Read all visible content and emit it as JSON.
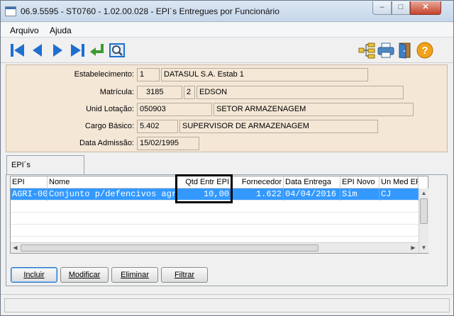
{
  "window": {
    "title": "06.9.5595 - ST0760 - 1.02.00.028 - EPI´s Entregues por Funcionário"
  },
  "menu": {
    "items": [
      {
        "label": "Arquivo"
      },
      {
        "label": "Ajuda"
      }
    ]
  },
  "toolbar": {
    "icons": [
      "first-icon",
      "previous-icon",
      "next-icon",
      "last-icon",
      "goto-icon",
      "search-icon",
      "tree-icon",
      "print-icon",
      "exit-icon",
      "help-icon"
    ]
  },
  "form": {
    "estabelecimento": {
      "label": "Estabelecimento:",
      "code": "1",
      "name": "DATASUL S.A. Estab 1"
    },
    "matricula": {
      "label": "Matrícula:",
      "number": "3185",
      "digit": "2",
      "name": "EDSON"
    },
    "unid_lotacao": {
      "label": "Unid Lotação:",
      "code": "050903",
      "name": "SETOR ARMAZENAGEM"
    },
    "cargo_basico": {
      "label": "Cargo Básico:",
      "code": "5.402",
      "name": "SUPERVISOR DE ARMAZENAGEM"
    },
    "data_admissao": {
      "label": "Data Admissão:",
      "value": "15/02/1995"
    }
  },
  "tab": {
    "label": "EPI´s"
  },
  "grid": {
    "columns": [
      "EPI",
      "Nome",
      "Qtd Entr EPI",
      "Fornecedor",
      "Data Entrega",
      "EPI Novo",
      "Un Med EPI"
    ],
    "rows": [
      {
        "epi": "AGRI-00",
        "nome": "Conjunto p/defencivos agricola",
        "qtd": "10,00",
        "fornecedor": "1.622",
        "data": "04/04/2016",
        "novo": "Sim",
        "unmed": "CJ"
      }
    ]
  },
  "buttons": {
    "incluir": "Incluir",
    "modificar": "Modificar",
    "eliminar": "Eliminar",
    "filtrar": "Filtrar"
  },
  "colors": {
    "selection": "#3399ff",
    "form_bg": "#f4e7d6",
    "toolbar_blue": "#1f6fd1"
  }
}
